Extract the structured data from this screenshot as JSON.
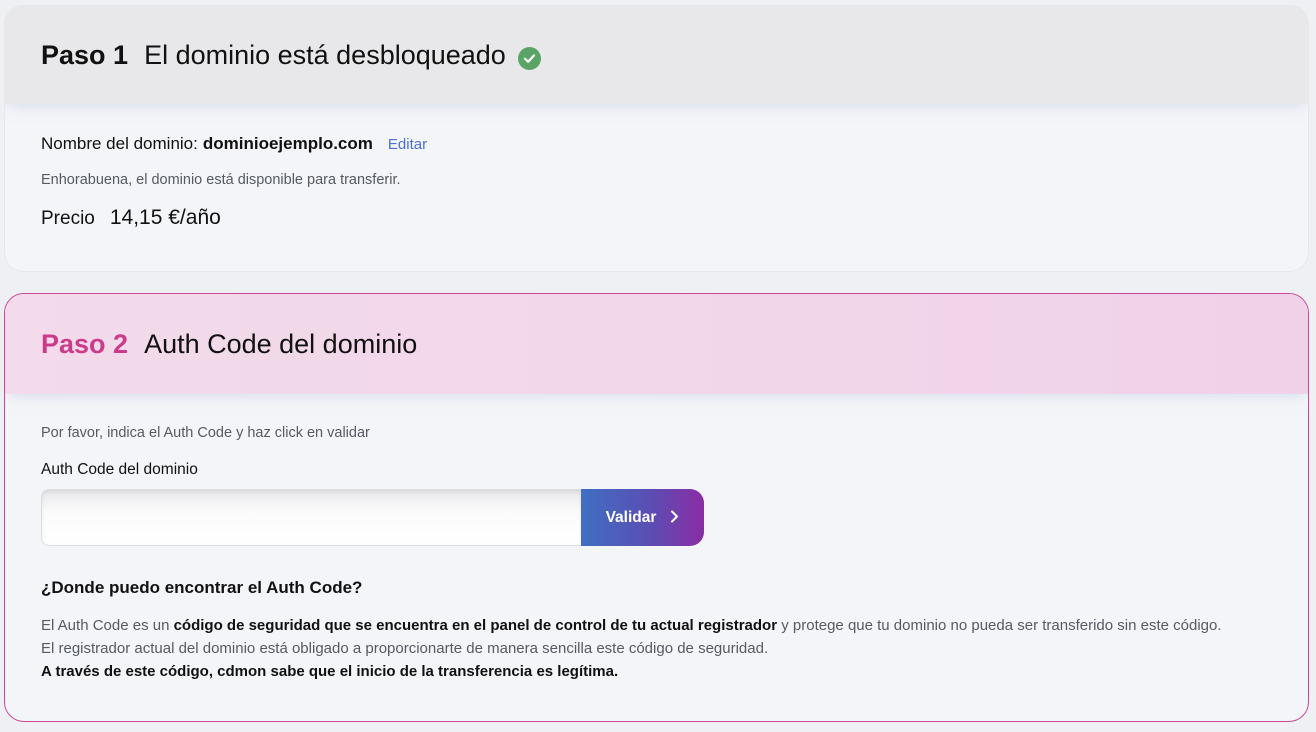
{
  "step1": {
    "step_label": "Paso 1",
    "title": "El dominio está desbloqueado",
    "status_icon": "check-circle-icon",
    "domain_label": "Nombre del dominio:",
    "domain_value": "dominioejemplo.com",
    "edit_label": "Editar",
    "availability_text": "Enhorabuena, el dominio está disponible para transferir.",
    "price_label": "Precio",
    "price_value": "14,15 €/año"
  },
  "step2": {
    "step_label": "Paso 2",
    "title": "Auth Code del dominio",
    "instruction": "Por favor, indica el Auth Code y haz click en validar",
    "field_label": "Auth Code del dominio",
    "input_value": "",
    "input_placeholder": "",
    "validate_label": "Validar",
    "validate_icon": "chevron-right-icon",
    "help_title": "¿Donde puedo encontrar el Auth Code?",
    "help_line1_a": "El Auth Code es un ",
    "help_line1_b": "código de seguridad que se encuentra en el panel de control de tu actual registrador",
    "help_line1_c": " y protege que tu dominio no pueda ser transferido sin este código.",
    "help_line2": "El registrador actual del dominio está obligado a proporcionarte de manera sencilla este código de seguridad.",
    "help_line3": "A través de este código, cdmon sabe que el inicio de la transferencia es legítima."
  },
  "colors": {
    "step2_accent": "#cc3b8b",
    "success": "#5aa466",
    "link": "#4b6fd6",
    "button_gradient_start": "#3f6fc2",
    "button_gradient_end": "#8a2da4"
  }
}
